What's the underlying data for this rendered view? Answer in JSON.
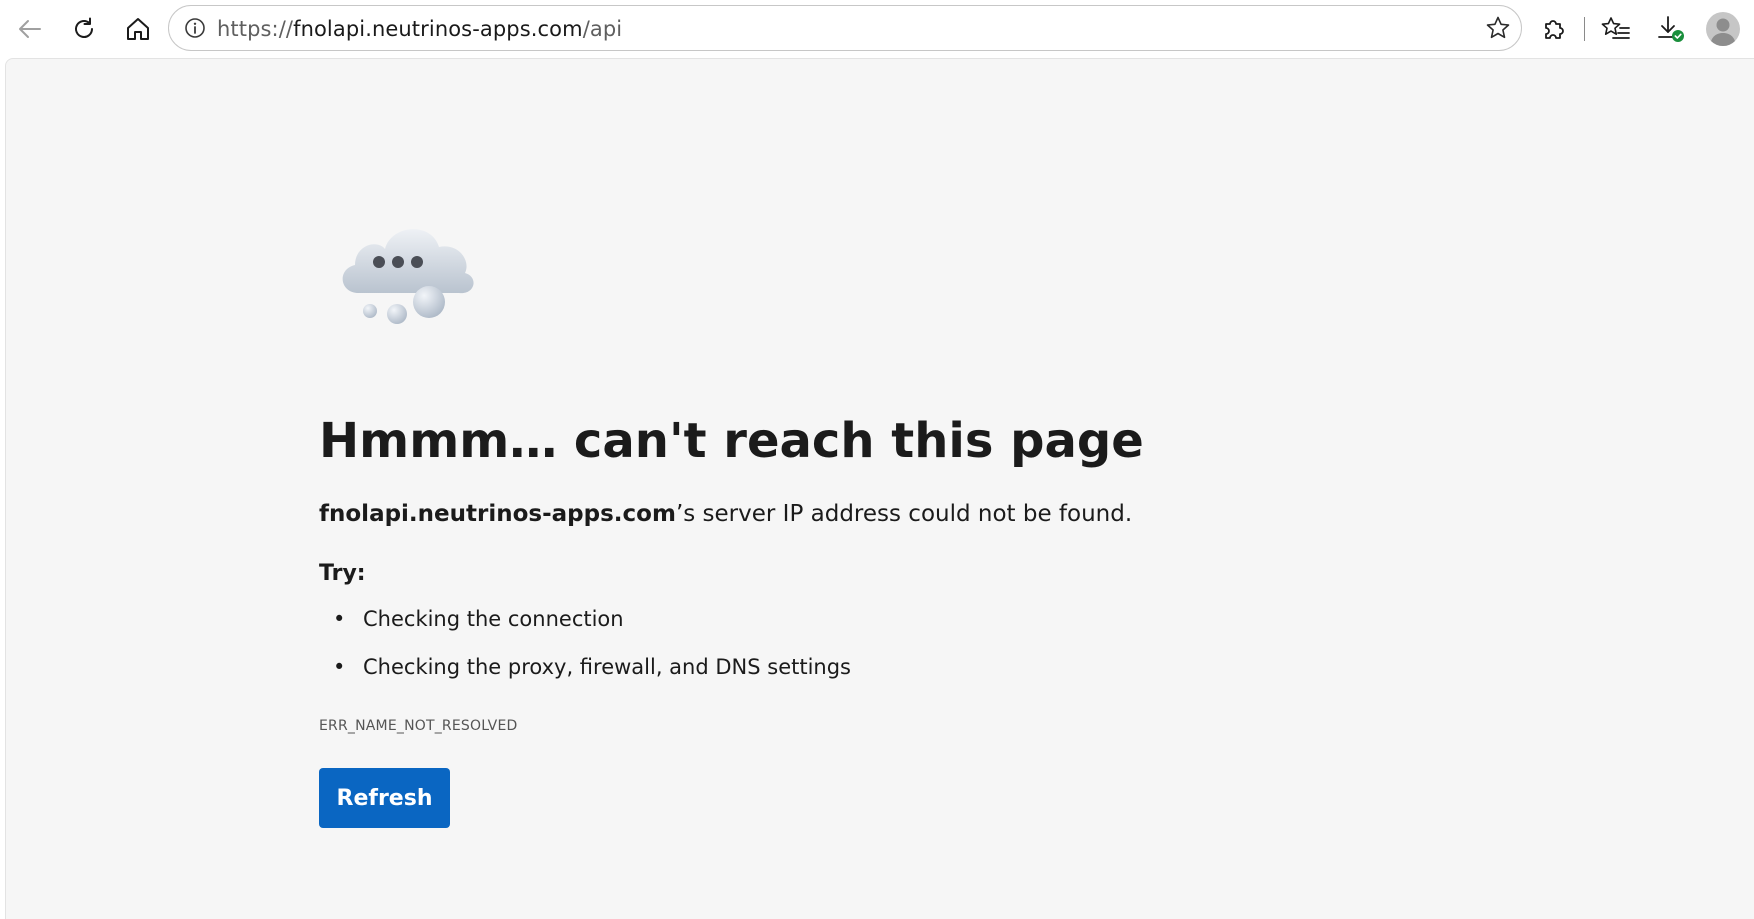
{
  "browser": {
    "address_bar": {
      "scheme": "https://",
      "host": "fnolapi.neutrinos-apps.com",
      "path": "/api"
    },
    "icons": {
      "back": "back-arrow-icon",
      "reload": "reload-icon",
      "home": "home-icon",
      "info": "info-icon",
      "favorite": "star-icon",
      "extensions": "puzzle-icon",
      "favorites": "favorites-list-icon",
      "downloads": "download-icon",
      "profile": "avatar-icon"
    }
  },
  "error_page": {
    "title": "Hmmm… can't reach this page",
    "host": "fnolapi.neutrinos-apps.com",
    "message_suffix": "’s server IP address could not be found.",
    "try_label": "Try:",
    "suggestions": [
      "Checking the connection",
      "Checking the proxy, firewall, and DNS settings"
    ],
    "error_code": "ERR_NAME_NOT_RESOLVED",
    "refresh_label": "Refresh"
  },
  "colors": {
    "accent": "#0a66c2",
    "page_background": "#f6f6f6",
    "download_badge": "#1a8f3c"
  }
}
